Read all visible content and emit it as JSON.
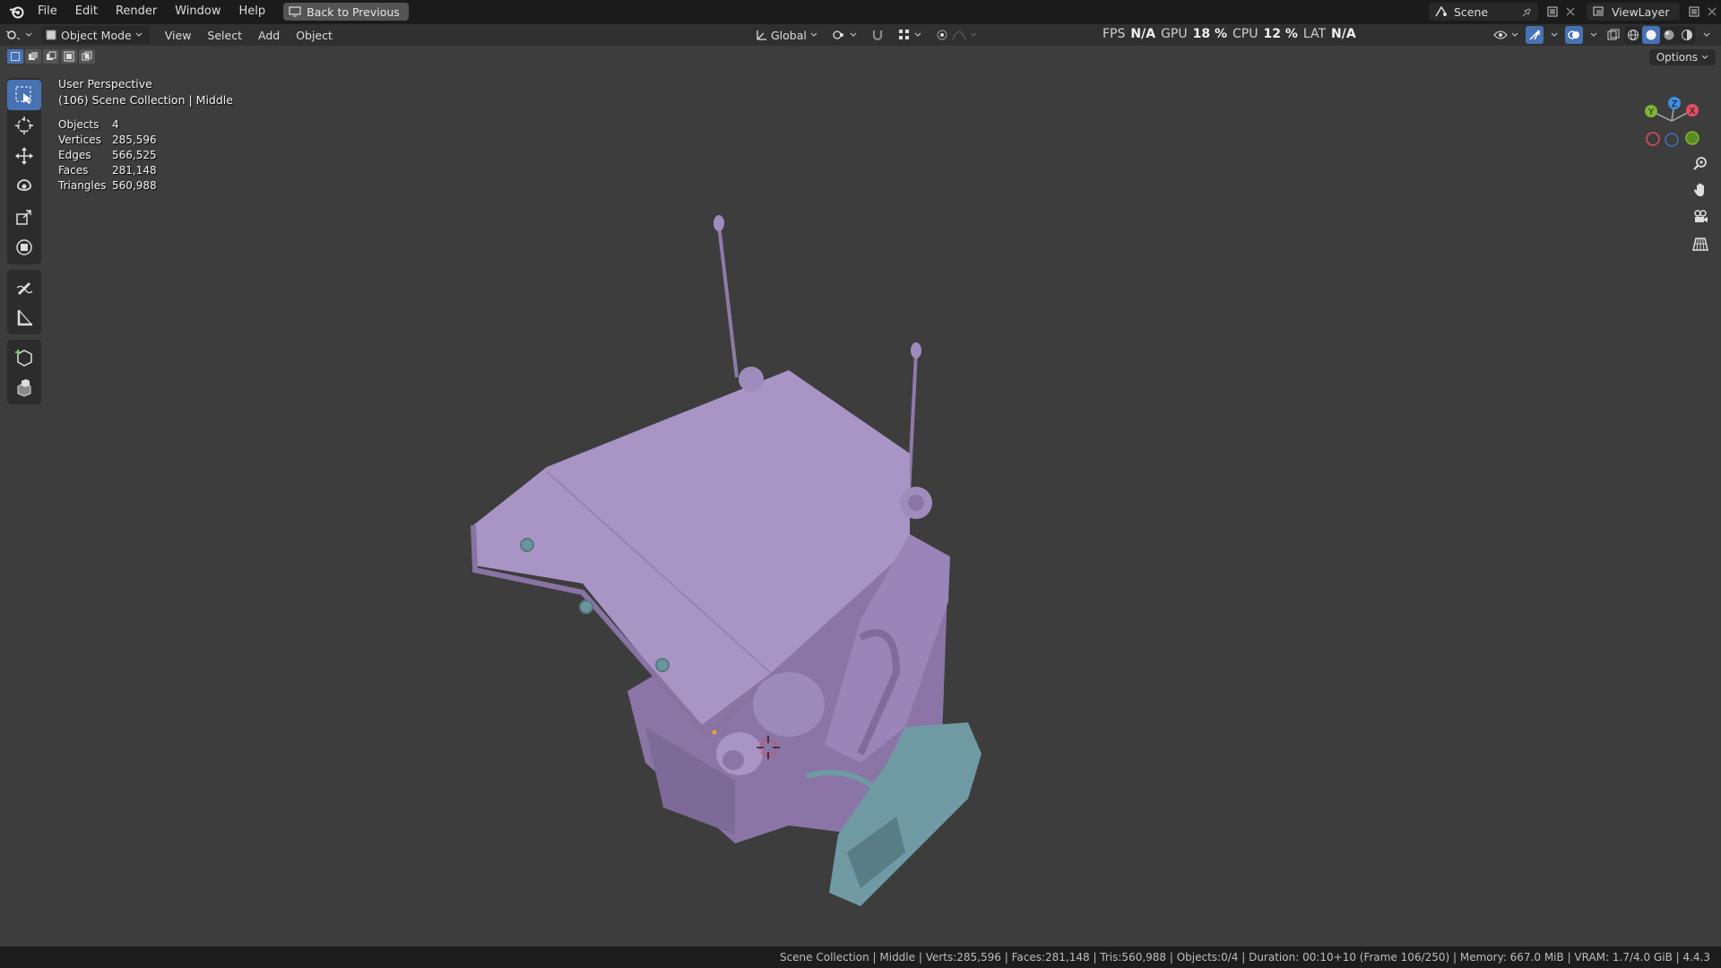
{
  "menu": {
    "items": [
      "File",
      "Edit",
      "Render",
      "Window",
      "Help"
    ],
    "back_button": "Back to Previous"
  },
  "topbar_right": {
    "scene_name": "Scene",
    "view_layer": "ViewLayer"
  },
  "viewport_header": {
    "mode": "Object Mode",
    "menus": [
      "View",
      "Select",
      "Add",
      "Object"
    ],
    "orientation": "Global"
  },
  "performance": {
    "fps_label": "FPS",
    "fps_value": "N/A",
    "gpu_label": "GPU",
    "gpu_value": "18 %",
    "cpu_label": "CPU",
    "cpu_value": "12 %",
    "lat_label": "LAT",
    "lat_value": "N/A"
  },
  "options_label": "Options",
  "overlay": {
    "view_name": "User Perspective",
    "collection": "(106) Scene Collection | Middle"
  },
  "stats": [
    {
      "label": "Objects",
      "value": "4"
    },
    {
      "label": "Vertices",
      "value": "285,596"
    },
    {
      "label": "Edges",
      "value": "566,525"
    },
    {
      "label": "Faces",
      "value": "281,148"
    },
    {
      "label": "Triangles",
      "value": "560,988"
    }
  ],
  "gizmo": {
    "y": "Y",
    "z": "Z",
    "x": "X"
  },
  "statusbar": "Scene Collection | Middle | Verts:285,596 | Faces:281,148 | Tris:560,988 | Objects:0/4 | Duration: 00:10+10 (Frame 106/250) | Memory: 667.0 MiB | VRAM: 1.7/4.0 GiB | 4.4.3",
  "colors": {
    "accent": "#4772b3",
    "model_purple": "#9a84b8",
    "model_teal": "#6f9aa3",
    "axis_x": "#e04d5e",
    "axis_y": "#7fb531",
    "axis_z": "#3d8fe0"
  }
}
